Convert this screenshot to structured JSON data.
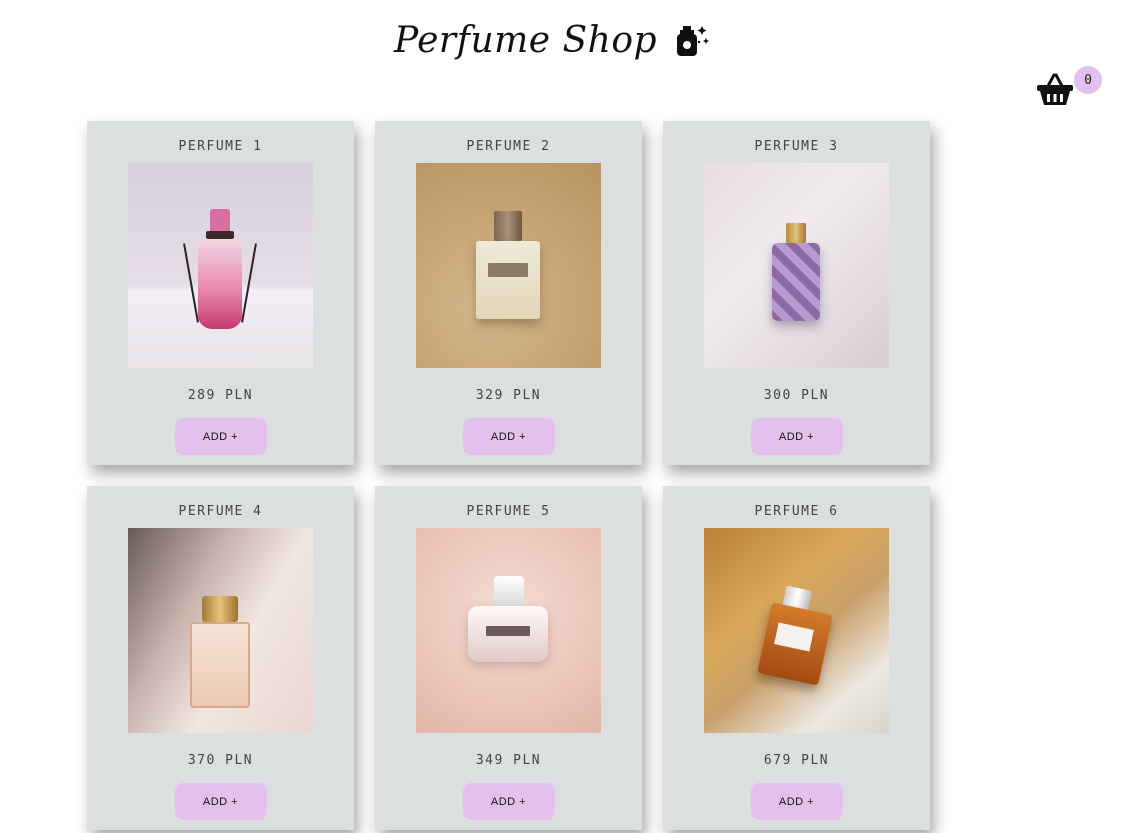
{
  "header": {
    "title": "Perfume Shop",
    "icon": "perfume-bottle-sparkle-icon"
  },
  "cart": {
    "icon": "basket-icon",
    "count": "0"
  },
  "colors": {
    "card_bg": "#dcdfe0",
    "accent": "#e4c1ec"
  },
  "products": [
    {
      "name": "PERFUME 1",
      "price": "289 PLN",
      "button": "ADD +"
    },
    {
      "name": "PERFUME 2",
      "price": "329 PLN",
      "button": "ADD +"
    },
    {
      "name": "PERFUME 3",
      "price": "300 PLN",
      "button": "ADD +"
    },
    {
      "name": "PERFUME 4",
      "price": "370 PLN",
      "button": "ADD +"
    },
    {
      "name": "PERFUME 5",
      "price": "349 PLN",
      "button": "ADD +"
    },
    {
      "name": "PERFUME 6",
      "price": "679 PLN",
      "button": "ADD +"
    }
  ]
}
